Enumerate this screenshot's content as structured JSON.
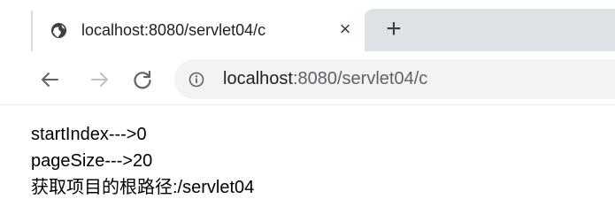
{
  "browser": {
    "tab": {
      "title": "localhost:8080/servlet04/c",
      "favicon": "globe-icon",
      "close_label": "×"
    },
    "new_tab_label": "+",
    "toolbar": {
      "back_icon": "arrow-left-icon",
      "forward_icon": "arrow-right-icon",
      "reload_icon": "reload-icon",
      "info_icon": "info-icon"
    },
    "address": {
      "host": "localhost",
      "rest": ":8080/servlet04/c"
    }
  },
  "page": {
    "lines": [
      "startIndex--->0",
      "pageSize--->20",
      "获取项目的根路径:/servlet04"
    ]
  },
  "colors": {
    "tab_strip_inactive": "#dee1e6",
    "omnibox_bg": "#f1f3f4",
    "text_primary": "#202124",
    "text_secondary": "#5f6368"
  }
}
